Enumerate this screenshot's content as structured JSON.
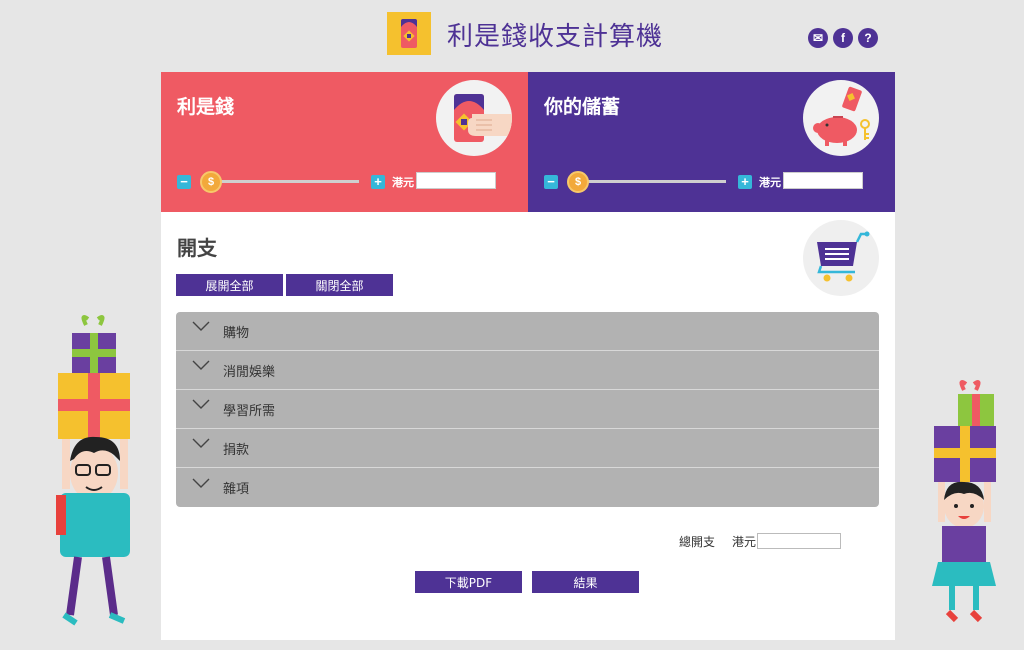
{
  "header": {
    "title": "利是錢收支計算機",
    "icons": [
      "mail-icon",
      "facebook-icon",
      "help-icon"
    ],
    "icon_glyphs": {
      "mail": "✉",
      "facebook": "f",
      "help": "?"
    }
  },
  "lucky_money": {
    "title": "利是錢",
    "currency": "港元",
    "amount": "",
    "minus": "−",
    "plus": "+",
    "coin_symbol": "$"
  },
  "savings": {
    "title": "你的儲蓄",
    "currency": "港元",
    "amount": "",
    "minus": "−",
    "plus": "+",
    "coin_symbol": "$"
  },
  "expenses": {
    "title": "開支",
    "expand_all": "展開全部",
    "collapse_all": "關閉全部",
    "categories": [
      {
        "label": "購物"
      },
      {
        "label": "消閒娛樂"
      },
      {
        "label": "學習所需"
      },
      {
        "label": "捐款"
      },
      {
        "label": "雜項"
      }
    ]
  },
  "total": {
    "label": "總開支",
    "currency": "港元",
    "amount": ""
  },
  "actions": {
    "download_pdf": "下載PDF",
    "result": "結果"
  },
  "colors": {
    "purple": "#4e3295",
    "red": "#ef5a63",
    "yellow": "#f5c12e",
    "accordion_gray": "#b2b2b2",
    "slider_button": "#35b7d9",
    "coin": "#f2a93b"
  }
}
